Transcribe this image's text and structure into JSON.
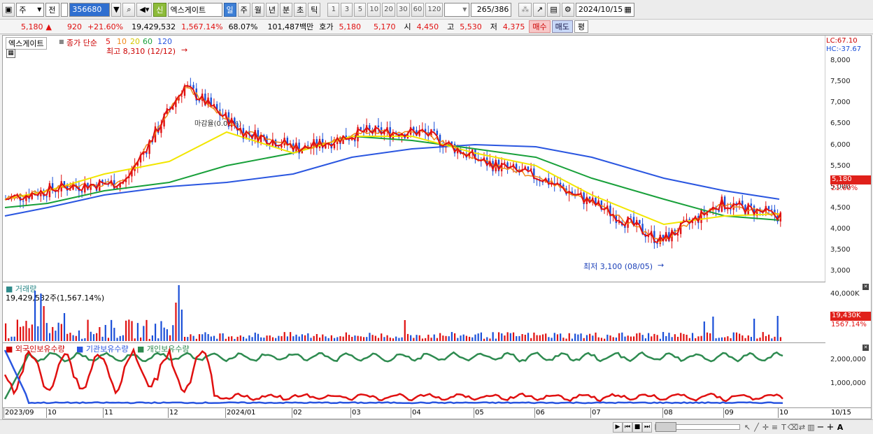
{
  "toolbar": {
    "market_select": "주",
    "prev_label": "전",
    "code": "356680",
    "stock_type": "신",
    "stock_name": "엑스게이트",
    "periods": [
      "일",
      "주",
      "월",
      "년",
      "분",
      "초",
      "틱"
    ],
    "active_period": "일",
    "intervals": [
      "1",
      "3",
      "5",
      "10",
      "20",
      "30",
      "60",
      "120"
    ],
    "count_current": "265",
    "count_total": "/386",
    "date": "2024/10/15"
  },
  "quote": {
    "price": "5,180",
    "arrow": "▲",
    "change": "920",
    "change_pct": "+21.60%",
    "volume": "19,429,532",
    "volume_ratio": "1,567.14%",
    "turnover": "68.07%",
    "amount": "101,487백만",
    "bid_label": "호가",
    "ask": "5,180",
    "bid": "5,170",
    "open_label": "시",
    "open": "4,450",
    "high_label": "고",
    "high": "5,530",
    "low_label": "저",
    "low": "4,375",
    "buy_label": "매수",
    "sell_label": "매도",
    "flat_label": "평"
  },
  "price_pane": {
    "title": "엑스게이트",
    "ma_label": "종가 단순",
    "ma_periods": [
      "5",
      "10",
      "20",
      "60",
      "120"
    ],
    "ma_colors": [
      "#e01010",
      "#f08a1a",
      "#f2e600",
      "#18a03a",
      "#2a56e0"
    ],
    "high_annot": "최고 8,310 (12/12)",
    "low_annot": "최저 3,100 (08/05)",
    "mid_annot": "마감율(0.00%)",
    "lc_label": "LC:67.10",
    "hc_label": "HC:-37.67",
    "y_ticks": [
      "8,000",
      "7,500",
      "7,000",
      "6,500",
      "6,000",
      "5,500",
      "5,000",
      "4,500",
      "4,000",
      "3,500",
      "3,000"
    ],
    "last_price": "5,180",
    "last_pct": "21.60%"
  },
  "volume_pane": {
    "title": "거래량",
    "value_label": "19,429,532주(1,567.14%)",
    "y_tick": "40,000K",
    "last_value": "19,430K",
    "last_pct": "1567.14%"
  },
  "holdings_pane": {
    "series": [
      "외국인보유수량",
      "기관보유수량",
      "개인보유수량"
    ],
    "series_colors": [
      "#e01010",
      "#2a56e0",
      "#2e8b50"
    ],
    "y_ticks": [
      "2,000,000",
      "1,000,000"
    ]
  },
  "x_axis": [
    "2023/09",
    "10",
    "11",
    "12",
    "2024/01",
    "02",
    "03",
    "04",
    "05",
    "06",
    "07",
    "08",
    "09",
    "10"
  ],
  "x_axis_end": "10/15",
  "chart_data": {
    "type": "line",
    "title": "엑스게이트",
    "x_range": [
      "2023/09",
      "2024/10/15"
    ],
    "ylim": [
      3000,
      8300
    ],
    "series": [
      {
        "name": "120",
        "values": [
          4300,
          4500,
          4800,
          5000,
          5100,
          5300,
          5700,
          5900,
          6000,
          5950,
          5700,
          5200,
          4900,
          4700
        ]
      },
      {
        "name": "60",
        "values": [
          4500,
          4600,
          4900,
          5100,
          5500,
          5800,
          6200,
          6100,
          5900,
          5700,
          5200,
          4700,
          4300,
          4200
        ]
      },
      {
        "name": "20",
        "values": [
          4700,
          4900,
          5300,
          5600,
          6300,
          5800,
          6200,
          6200,
          5800,
          5500,
          4800,
          4100,
          4300,
          4350
        ]
      }
    ],
    "annotations": [
      "최고 8,310 (12/12)",
      "최저 3,100 (08/05)"
    ]
  }
}
